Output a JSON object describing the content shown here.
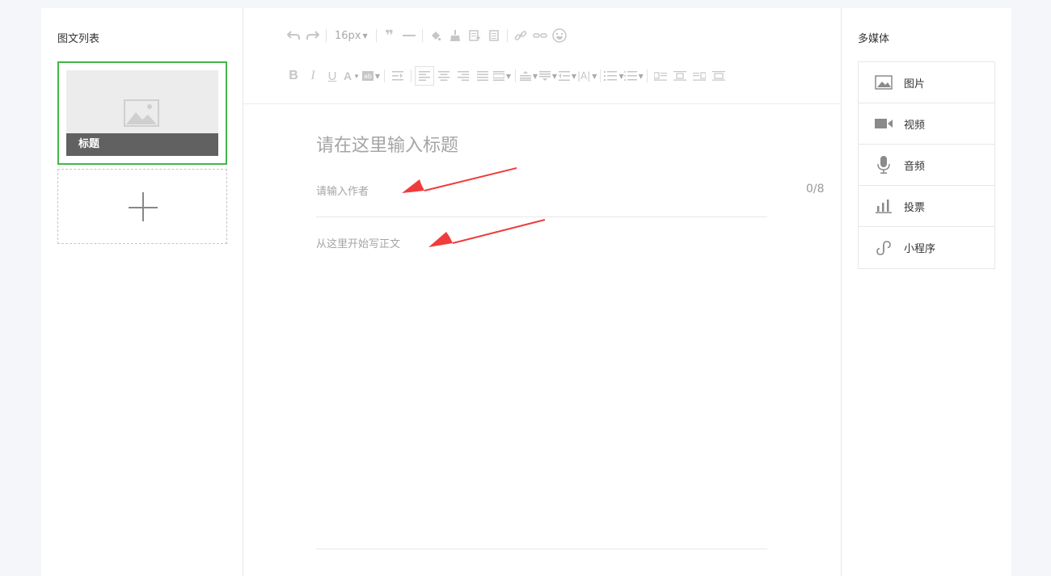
{
  "left_panel": {
    "title": "图文列表",
    "articles": [
      {
        "title": "标题"
      }
    ]
  },
  "toolbar": {
    "font_size": "16px"
  },
  "editor": {
    "title_placeholder": "请在这里输入标题",
    "author_placeholder": "请输入作者",
    "author_count": "0/8",
    "body_placeholder": "从这里开始写正文"
  },
  "right_panel": {
    "title": "多媒体",
    "items": [
      {
        "label": "图片",
        "icon": "image-icon"
      },
      {
        "label": "视频",
        "icon": "video-icon"
      },
      {
        "label": "音频",
        "icon": "microphone-icon"
      },
      {
        "label": "投票",
        "icon": "poll-icon"
      },
      {
        "label": "小程序",
        "icon": "mini-program-icon"
      }
    ]
  },
  "colors": {
    "selected_border": "#44b549",
    "annotation_arrow": "#f03c3c"
  }
}
